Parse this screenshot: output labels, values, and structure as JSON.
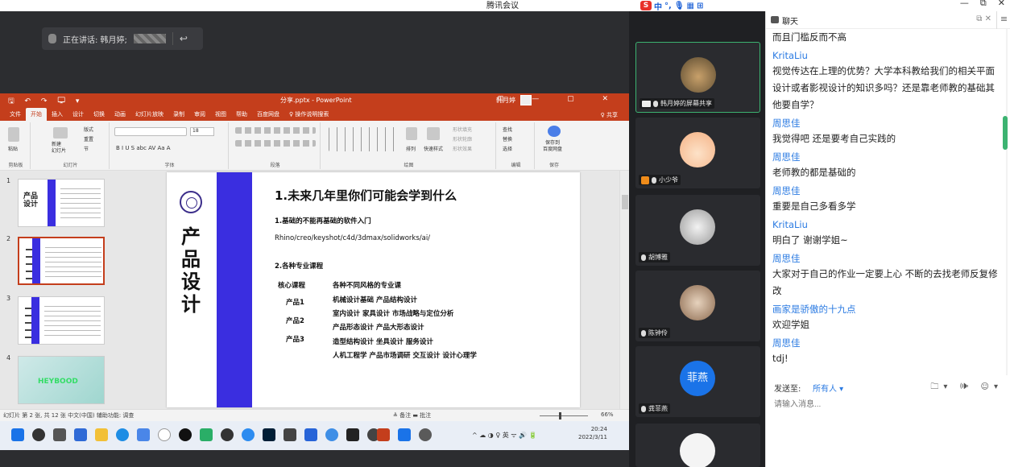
{
  "window": {
    "title": "腾讯会议",
    "minimize": "—",
    "maximize": "⧉",
    "close": "✕"
  },
  "ime": {
    "mode": "中",
    "punct": "°,",
    "mic": "🎙",
    "kbd": "▦",
    "apps": "⊞"
  },
  "speaker_bar": {
    "label": "正在讲话: 韩月婷;",
    "return_icon": "↩"
  },
  "ppt": {
    "quick_access": "🖫 ↶ ↷ 🖵 ▾",
    "filename": "分享.pptx - PowerPoint",
    "user": "韩月婷",
    "window_controls": "⊡ — ▢ ✕",
    "tabs": [
      "文件",
      "开始",
      "插入",
      "设计",
      "切换",
      "动画",
      "幻灯片放映",
      "录制",
      "审阅",
      "视图",
      "帮助",
      "百度网盘",
      "♀ 操作说明搜索"
    ],
    "share": "♀ 共享",
    "ribbon": {
      "clipboard": {
        "label": "剪贴板",
        "paste": "粘贴"
      },
      "slides": {
        "label": "幻灯片",
        "new": "新建\n幻灯片",
        "layout": "版式",
        "reset": "重置",
        "section": "节"
      },
      "font": {
        "label": "字体",
        "size": "18",
        "buttons": "B  I  U  S  abc  AV  Aa  A"
      },
      "paragraph": {
        "label": "段落"
      },
      "drawing": {
        "label": "绘图",
        "arrange": "排列",
        "quick_styles": "快速样式",
        "fill": "形状填充",
        "outline": "形状轮廓",
        "effect": "形状效果"
      },
      "editing": {
        "label": "编辑",
        "find": "查找",
        "replace": "替换",
        "select": "选择"
      },
      "save": {
        "label": "保存",
        "to_baidu": "保存到\n百度网盘"
      }
    },
    "thumbnails": [
      {
        "num": "1",
        "big": "产品\n设计"
      },
      {
        "num": "2",
        "big": ""
      },
      {
        "num": "3",
        "big": ""
      },
      {
        "num": "4",
        "big": "",
        "img_text": "HEYBOOD"
      }
    ],
    "slide": {
      "vertical_title": "产品设计",
      "heading": "1.未来几年里你们可能会学到什么",
      "s1": "1.基础的不能再基础的软件入门",
      "software": "Rhino/creo/keyshot/c4d/3dmax/solidworks/ai/",
      "s2": "2.各种专业课程",
      "col1": "核心课程",
      "col2": "各种不同风格的专业课",
      "rows": [
        {
          "label": "产品1",
          "text": "机械设计基础  产品结构设计"
        },
        {
          "label": "",
          "text": "室内设计  家具设计  市场战略与定位分析"
        },
        {
          "label": "产品2",
          "text": "产品形态设计  产品大形态设计"
        },
        {
          "label": "",
          "text": "造型结构设计  坐具设计  服务设计"
        },
        {
          "label": "产品3",
          "text": "人机工程学  产品市场调研  交互设计  设计心理学"
        }
      ]
    },
    "status": {
      "left": "幻灯片 第 2 张, 共 12 张    中文(中国)    辅助功能: 调查",
      "right": "≜ 备注    ▬ 批注",
      "zoom": "66%"
    }
  },
  "taskbar": {
    "tray": "^  ☁  ◑  ♀  英  ᯤ  🔊  🔋",
    "time": "20:24",
    "date": "2022/3/11"
  },
  "participants": [
    {
      "name": "韩月婷的屏幕共享",
      "avatar_color": "#5a4a30",
      "active": true,
      "screen": true,
      "hand": false
    },
    {
      "name": "小少爷",
      "avatar_color": "#f4b184",
      "active": false,
      "screen": false,
      "hand": true
    },
    {
      "name": "胡博雅",
      "avatar_color": "#d9d9d9",
      "active": false,
      "screen": false,
      "hand": false
    },
    {
      "name": "陈钟伶",
      "avatar_color": "#c9a98c",
      "active": false,
      "screen": false,
      "hand": false
    },
    {
      "name": "龚菲燕",
      "avatar_text": "菲燕",
      "avatar_color": "#1a73e8",
      "active": false,
      "screen": false,
      "hand": false
    },
    {
      "name": "",
      "avatar_color": "#eeeeee",
      "active": false,
      "screen": false,
      "hand": false
    }
  ],
  "chat": {
    "title": "聊天",
    "header_ctl": "⧉ ✕",
    "menu": "≡",
    "messages": [
      {
        "name": "",
        "text": "而且门槛反而不高"
      },
      {
        "name": "KritaLiu",
        "text": "视觉传达在上理的优势？大学本科教给我们的相关平面设计或者影视设计的知识多吗？还是靠老师教的基础其他要自学？"
      },
      {
        "name": "周思佳",
        "text": "我觉得吧 还是要考自己实践的"
      },
      {
        "name": "周思佳",
        "text": "老师教的都是基础的"
      },
      {
        "name": "周思佳",
        "text": "重要是自己多看多学"
      },
      {
        "name": "KritaLiu",
        "text": "明白了 谢谢学姐~"
      },
      {
        "name": "周思佳",
        "text": "大家对于自己的作业一定要上心 不断的去找老师反复修改"
      },
      {
        "name": "画家是骄傲的十九点",
        "text": "欢迎学姐"
      },
      {
        "name": "周思佳",
        "text": "tdj!"
      }
    ],
    "send_to_label": "发送至:",
    "send_to_value": "所有人 ▾",
    "tools": "🗀▾ 🕪 ☺▾",
    "input_placeholder": "请输入消息..."
  }
}
